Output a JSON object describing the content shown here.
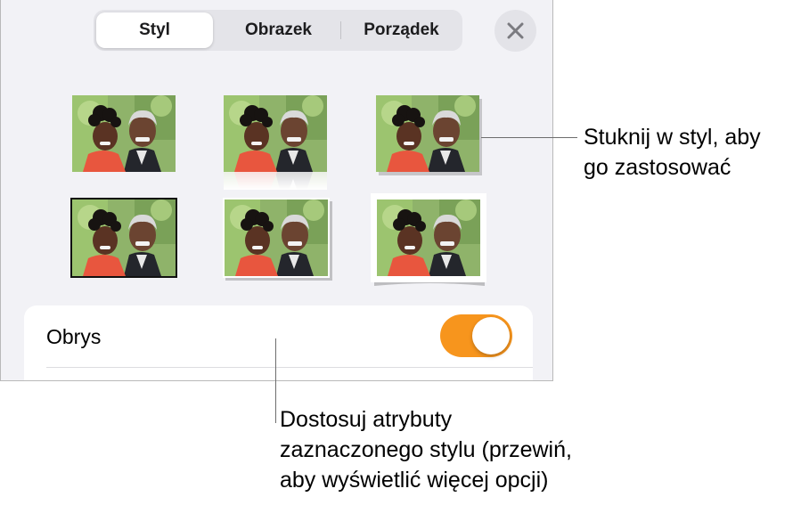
{
  "tabs": [
    {
      "label": "Styl",
      "active": true
    },
    {
      "label": "Obrazek",
      "active": false
    },
    {
      "label": "Porządek",
      "active": false
    }
  ],
  "close_icon": "close-icon",
  "style_presets": [
    {
      "style": "no-border"
    },
    {
      "style": "reflection"
    },
    {
      "style": "shadow"
    },
    {
      "style": "thick-black-border"
    },
    {
      "style": "thin-border-shadow"
    },
    {
      "style": "white-border-curved-shadow"
    }
  ],
  "outline": {
    "label": "Obrys",
    "enabled": true,
    "toggle_color": "#f7951d"
  },
  "callouts": {
    "style_line1": "Stuknij w styl, aby",
    "style_line2": "go zastosować",
    "attr_line1": "Dostosuj atrybuty",
    "attr_line2": "zaznaczonego stylu (przewiń,",
    "attr_line3": "aby wyświetlić więcej opcji)"
  }
}
